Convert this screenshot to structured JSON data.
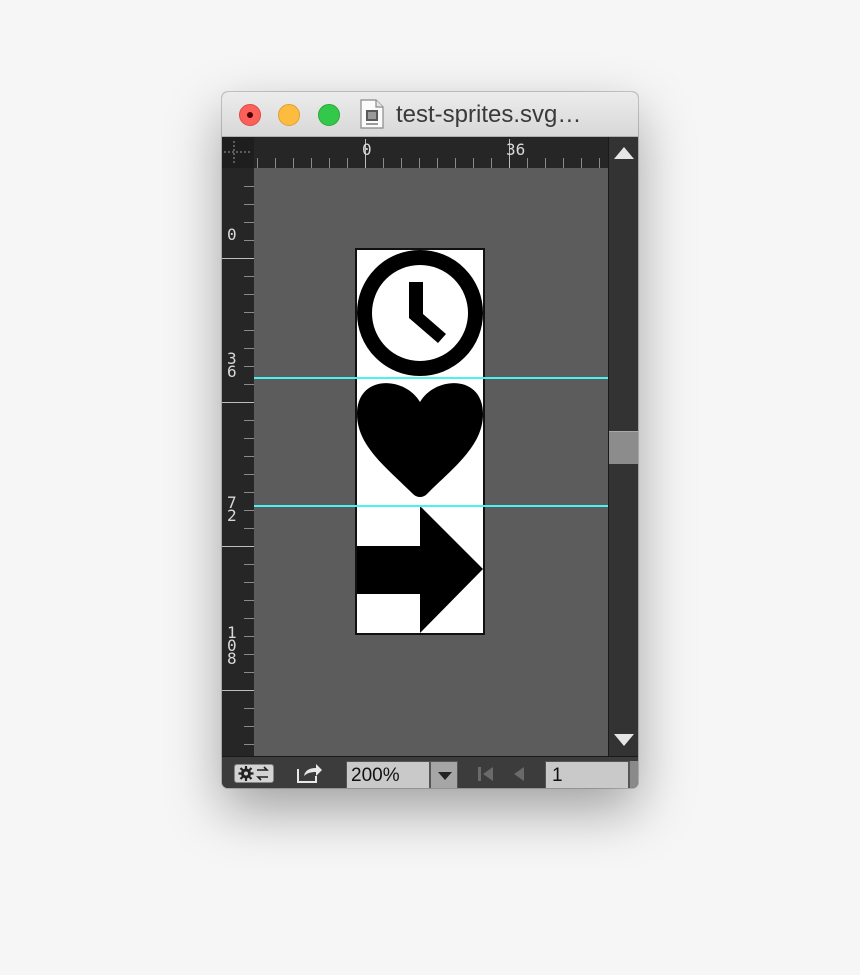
{
  "window": {
    "title": "test-sprites.svg…"
  },
  "rulers": {
    "horizontal_labels": [
      "0",
      "36"
    ],
    "vertical_labels": [
      "0",
      "36",
      "72",
      "108"
    ]
  },
  "artboard": {
    "sprites": [
      "clock-icon",
      "heart-icon",
      "arrow-right-icon"
    ],
    "guide_color": "#4af2f2"
  },
  "statusbar": {
    "zoom": "200%",
    "page": "1"
  }
}
